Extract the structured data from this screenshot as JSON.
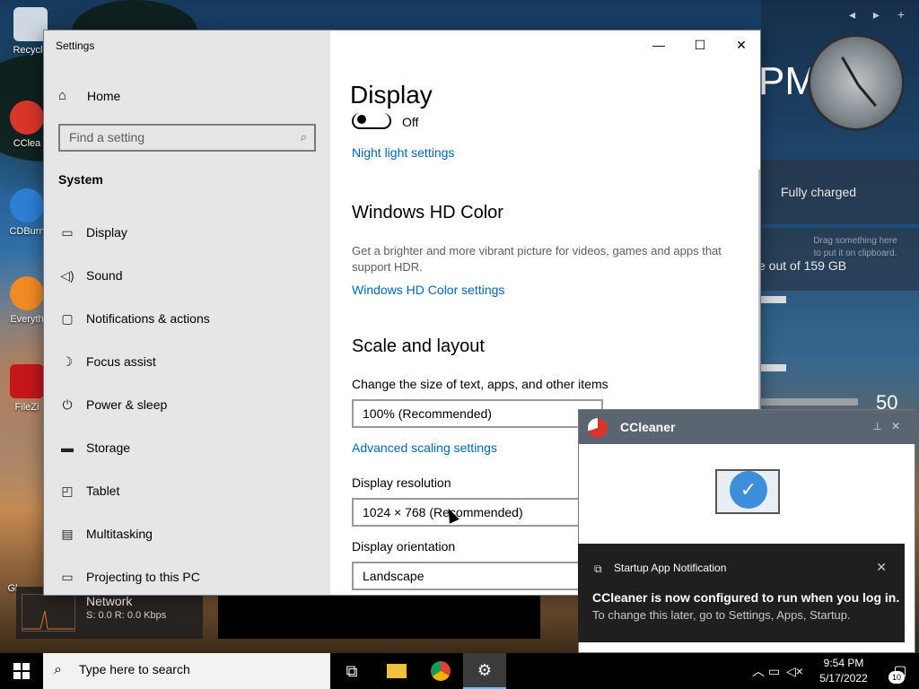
{
  "desktop": {
    "icons": [
      {
        "label": "Recycle"
      },
      {
        "label": "CClea"
      },
      {
        "label": "CDBurn"
      },
      {
        "label": "Everyth"
      },
      {
        "label": "FileZi"
      },
      {
        "label": "Gl"
      }
    ]
  },
  "widgets": {
    "nav": "◂ ▸ +",
    "time_suffix": "PM",
    "battery": "Fully charged",
    "clipboard_hint": "Drag something here to put it on clipboard.",
    "disk": "e out of 159 GB",
    "volume": "50",
    "network": {
      "title": "Network",
      "stats": "S: 0.0 R: 0.0 Kbps"
    }
  },
  "settings": {
    "window_title": "Settings",
    "home_label": "Home",
    "search_placeholder": "Find a setting",
    "section": "System",
    "nav": [
      {
        "icon": "monitor-icon",
        "label": "Display"
      },
      {
        "icon": "speaker-icon",
        "label": "Sound"
      },
      {
        "icon": "message-icon",
        "label": "Notifications & actions"
      },
      {
        "icon": "moon-icon",
        "label": "Focus assist"
      },
      {
        "icon": "power-icon",
        "label": "Power & sleep"
      },
      {
        "icon": "storage-icon",
        "label": "Storage"
      },
      {
        "icon": "tablet-icon",
        "label": "Tablet"
      },
      {
        "icon": "multitasking-icon",
        "label": "Multitasking"
      },
      {
        "icon": "projector-icon",
        "label": "Projecting to this PC"
      }
    ],
    "content": {
      "title": "Display",
      "night_light_state": "Off",
      "night_light_link": "Night light settings",
      "hd_heading": "Windows HD Color",
      "hd_desc": "Get a brighter and more vibrant picture for videos, games and apps that support HDR.",
      "hd_link": "Windows HD Color settings",
      "scale_heading": "Scale and layout",
      "scale_label": "Change the size of text, apps, and other items",
      "scale_value": "100% (Recommended)",
      "adv_scaling_link": "Advanced scaling settings",
      "resolution_label": "Display resolution",
      "resolution_value": "1024 × 768 (Recommended)",
      "orientation_label": "Display orientation",
      "orientation_value": "Landscape"
    }
  },
  "ccleaner": {
    "title": "CCleaner"
  },
  "toast": {
    "app_name": "Startup App Notification",
    "title": "CCleaner is now configured to run when you log in.",
    "body": "To change this later, go to Settings, Apps, Startup."
  },
  "taskbar": {
    "search_placeholder": "Type here to search",
    "time": "9:54 PM",
    "date": "5/17/2022",
    "notification_count": "10"
  }
}
